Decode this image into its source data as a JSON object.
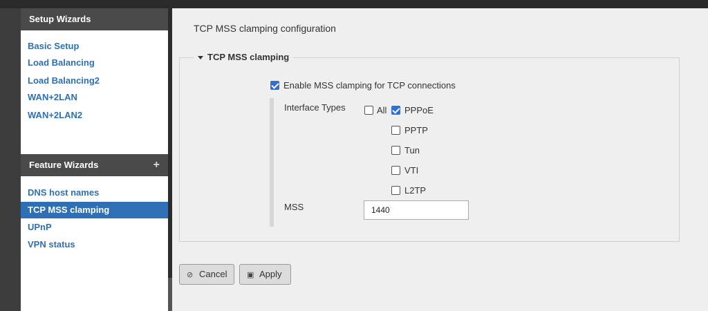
{
  "sidebar": {
    "setup_header": "Setup Wizards",
    "setup_items": [
      {
        "label": "Basic Setup"
      },
      {
        "label": "Load Balancing"
      },
      {
        "label": "Load Balancing2"
      },
      {
        "label": "WAN+2LAN"
      },
      {
        "label": "WAN+2LAN2"
      }
    ],
    "feature_header": "Feature Wizards",
    "feature_expand": "+",
    "feature_items": [
      {
        "label": "DNS host names"
      },
      {
        "label": "TCP MSS clamping"
      },
      {
        "label": "UPnP"
      },
      {
        "label": "VPN status"
      }
    ]
  },
  "main": {
    "title": "TCP MSS clamping configuration",
    "section_legend": "TCP MSS clamping",
    "enable_label": "Enable MSS clamping for TCP connections",
    "enable_checked": true,
    "interface_types_label": "Interface Types",
    "interfaces": [
      {
        "label": "All",
        "checked": false
      },
      {
        "label": "PPPoE",
        "checked": true
      },
      {
        "label": "PPTP",
        "checked": false
      },
      {
        "label": "Tun",
        "checked": false
      },
      {
        "label": "VTI",
        "checked": false
      },
      {
        "label": "L2TP",
        "checked": false
      }
    ],
    "mss_label": "MSS",
    "mss_value": "1440"
  },
  "buttons": {
    "cancel_label": "Cancel",
    "apply_label": "Apply"
  },
  "colors": {
    "accent": "#2f6fb5",
    "checkbox_checked": "#2f6fd6",
    "sidebar_header_bg": "#4a4a4a"
  }
}
